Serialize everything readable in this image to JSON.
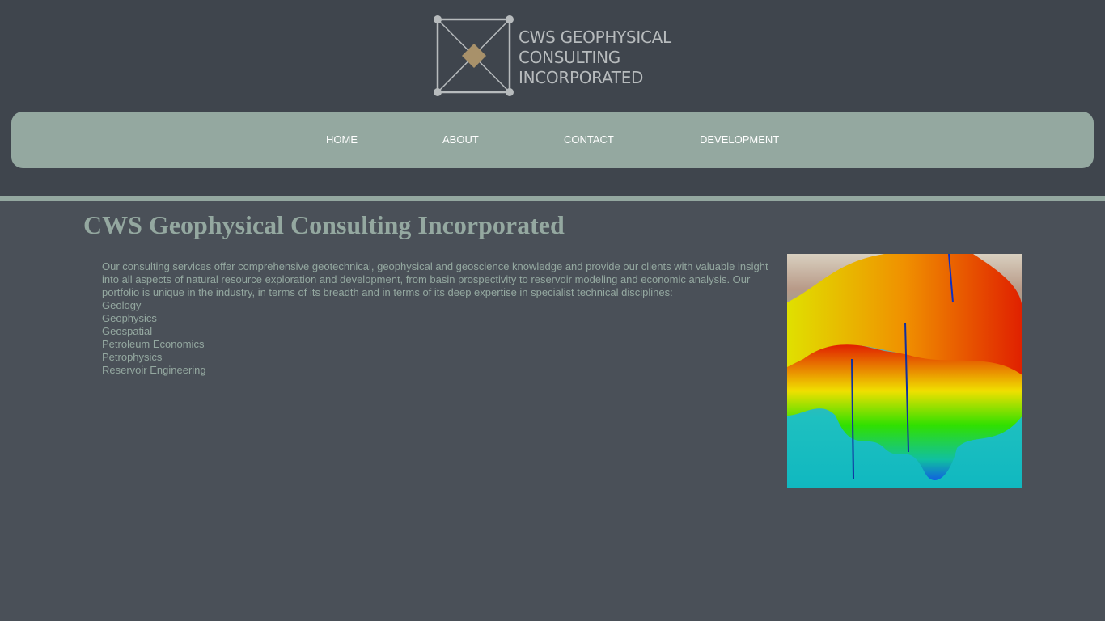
{
  "logo": {
    "lines": [
      "CWS GEOPHYSICAL",
      "CONSULTING",
      "INCORPORATED"
    ],
    "accent": "#a8916a"
  },
  "nav": [
    {
      "label": "HOME"
    },
    {
      "label": "ABOUT"
    },
    {
      "label": "CONTACT"
    },
    {
      "label": "DEVELOPMENT"
    }
  ],
  "page_title": "CWS Geophysical Consulting Incorporated",
  "intro": "Our consulting services offer comprehensive geotechnical, geophysical and geoscience knowledge and provide our clients with valuable insight into all aspects of natural resource exploration and development, from basin prospectivity to reservoir modeling and economic analysis. Our portfolio is unique in the industry, in terms of its breadth and in terms of its deep expertise in specialist technical disciplines:",
  "disciplines": [
    "Geology",
    "Geophysics",
    "Geospatial",
    "Petroleum Economics",
    "Petrophysics",
    "Reservoir Engineering"
  ]
}
